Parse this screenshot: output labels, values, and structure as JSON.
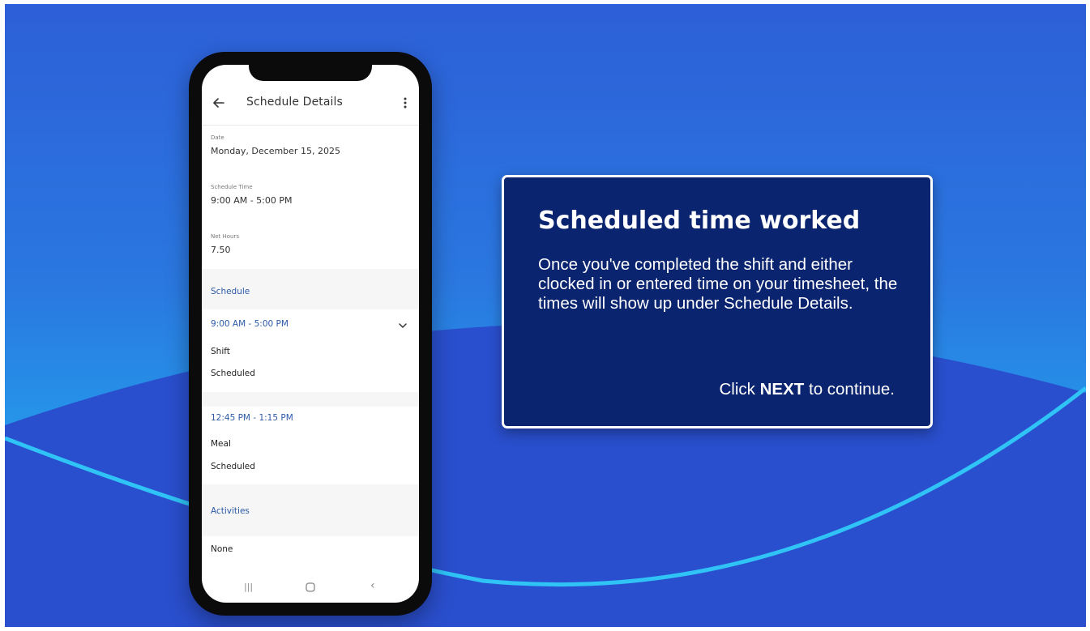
{
  "phone": {
    "header": {
      "title": "Schedule Details",
      "back_icon": "arrow-left-icon",
      "menu_icon": "more-vertical-icon"
    },
    "fields": [
      {
        "label": "Date",
        "value": "Monday, December 15, 2025"
      },
      {
        "label": "Schedule Time",
        "value": "9:00 AM - 5:00 PM"
      },
      {
        "label": "Net Hours",
        "value": "7.50"
      }
    ],
    "schedule_section": {
      "title": "Schedule",
      "entries": [
        {
          "time": "9:00 AM - 5:00 PM",
          "type": "Shift",
          "status": "Scheduled"
        },
        {
          "time": "12:45 PM - 1:15 PM",
          "type": "Meal",
          "status": "Scheduled"
        }
      ]
    },
    "activities_section": {
      "title": "Activities",
      "value": "None"
    },
    "nav": {
      "recent_glyph": "|||",
      "home_icon": "home-circle-icon",
      "back_glyph": "‹"
    }
  },
  "card": {
    "title": "Scheduled time worked",
    "body": "Once you've completed the shift and either clocked in or entered time on your timesheet, the times will show up under Schedule Details.",
    "cta_prefix": "Click ",
    "cta_bold": "NEXT",
    "cta_suffix": " to continue."
  },
  "colors": {
    "background_top": "#2d5fd8",
    "background_bottom": "#22b6f3",
    "card_fill": "#0b2470",
    "link_blue": "#2c5aa8"
  }
}
